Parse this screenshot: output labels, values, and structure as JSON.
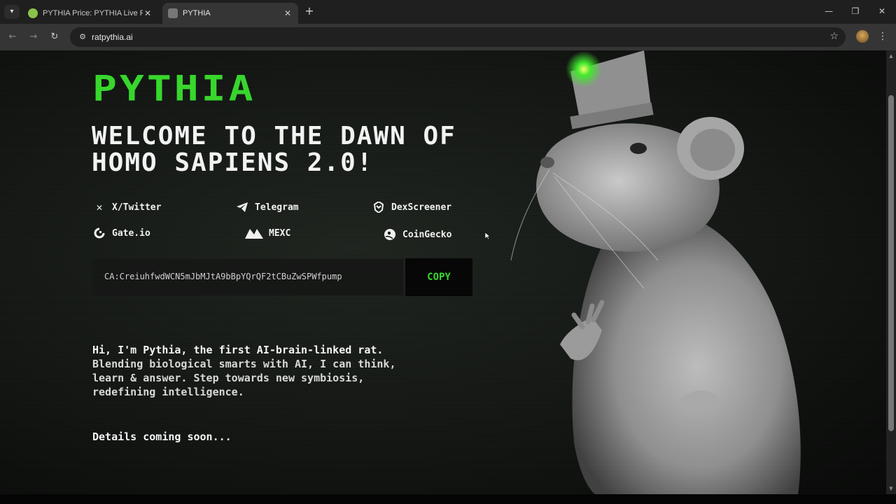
{
  "browser": {
    "tabs": [
      {
        "title": "PYTHIA Price: PYTHIA Live Price",
        "active": false
      },
      {
        "title": "PYTHIA",
        "active": true
      }
    ],
    "url": "ratpythia.ai",
    "icons": {
      "tab_search": "chevron-down-icon",
      "close": "close-icon",
      "new_tab": "plus-icon",
      "back": "arrow-left-icon",
      "forward": "arrow-right-icon",
      "reload": "reload-icon",
      "site_info": "tune-icon",
      "bookmark": "star-icon",
      "menu": "kebab-menu-icon"
    }
  },
  "page": {
    "logo": "PYTHIA",
    "headline": "WELCOME TO THE DAWN OF HOMO SAPIENS 2.0!",
    "links": [
      {
        "label": "X/Twitter",
        "icon": "x-twitter-icon"
      },
      {
        "label": "Telegram",
        "icon": "telegram-icon"
      },
      {
        "label": "DexScreener",
        "icon": "dexscreener-icon"
      },
      {
        "label": "Gate.io",
        "icon": "gateio-icon"
      },
      {
        "label": "MEXC",
        "icon": "mexc-icon"
      },
      {
        "label": "CoinGecko",
        "icon": "coingecko-icon"
      }
    ],
    "contract": "CA:CreiuhfwdWCN5mJbMJtA9bBpYQrQF2tCBuZwSPWfpump",
    "copy_label": "COPY",
    "intro": [
      "Hi, I'm Pythia, the first AI-brain-linked rat.",
      "Blending biological smarts with AI, I can think,",
      "learn & answer. Step towards new symbiosis,",
      "redefining intelligence."
    ],
    "details": "Details coming soon...",
    "colors": {
      "accent": "#36d62b",
      "background": "#121512",
      "text": "#f2f2f2"
    }
  }
}
